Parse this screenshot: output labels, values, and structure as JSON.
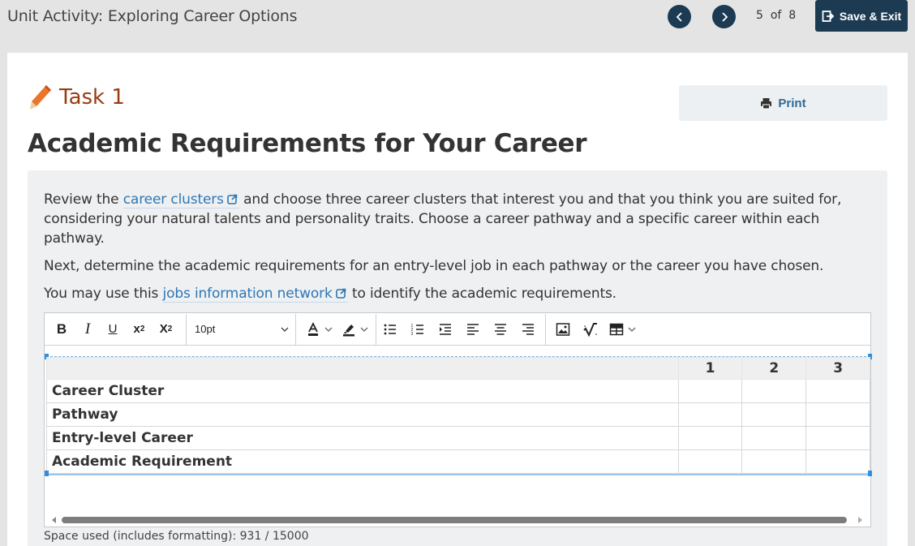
{
  "header": {
    "title": "Unit Activity: Exploring Career Options",
    "prev_label": "Previous",
    "next_label": "Next",
    "page_current": "5",
    "page_of": "of",
    "page_total": "8",
    "save_exit_label": "Save & Exit"
  },
  "task": {
    "label": "Task 1",
    "print_label": "Print",
    "title": "Academic Requirements for Your Career"
  },
  "instructions": {
    "p1_before": "Review the",
    "p1_link": "career clusters",
    "p1_after": "and choose three career clusters that interest you and that you think you are suited for, considering your natural talents and personality traits. Choose a career pathway and a specific career within each pathway.",
    "p2": "Next, determine the academic requirements for an entry-level job in each pathway or the career you have chosen.",
    "p3_before": "You may use this",
    "p3_link": "jobs information network",
    "p3_after": "to identify the academic requirements."
  },
  "editor": {
    "font_size": "10pt",
    "table": {
      "columns": [
        "",
        "1",
        "2",
        "3"
      ],
      "rows": [
        {
          "label": "Career Cluster",
          "cells": [
            "",
            "",
            ""
          ]
        },
        {
          "label": "Pathway",
          "cells": [
            "",
            "",
            ""
          ]
        },
        {
          "label": "Entry-level Career",
          "cells": [
            "",
            "",
            ""
          ]
        },
        {
          "label": "Academic Requirement",
          "cells": [
            "",
            "",
            ""
          ]
        }
      ]
    },
    "space_used": "Space used (includes formatting): 931 / 15000"
  },
  "colors": {
    "nav_dark": "#1c3b53",
    "task_orange": "#9a3c12",
    "link_blue": "#2f77b5"
  }
}
